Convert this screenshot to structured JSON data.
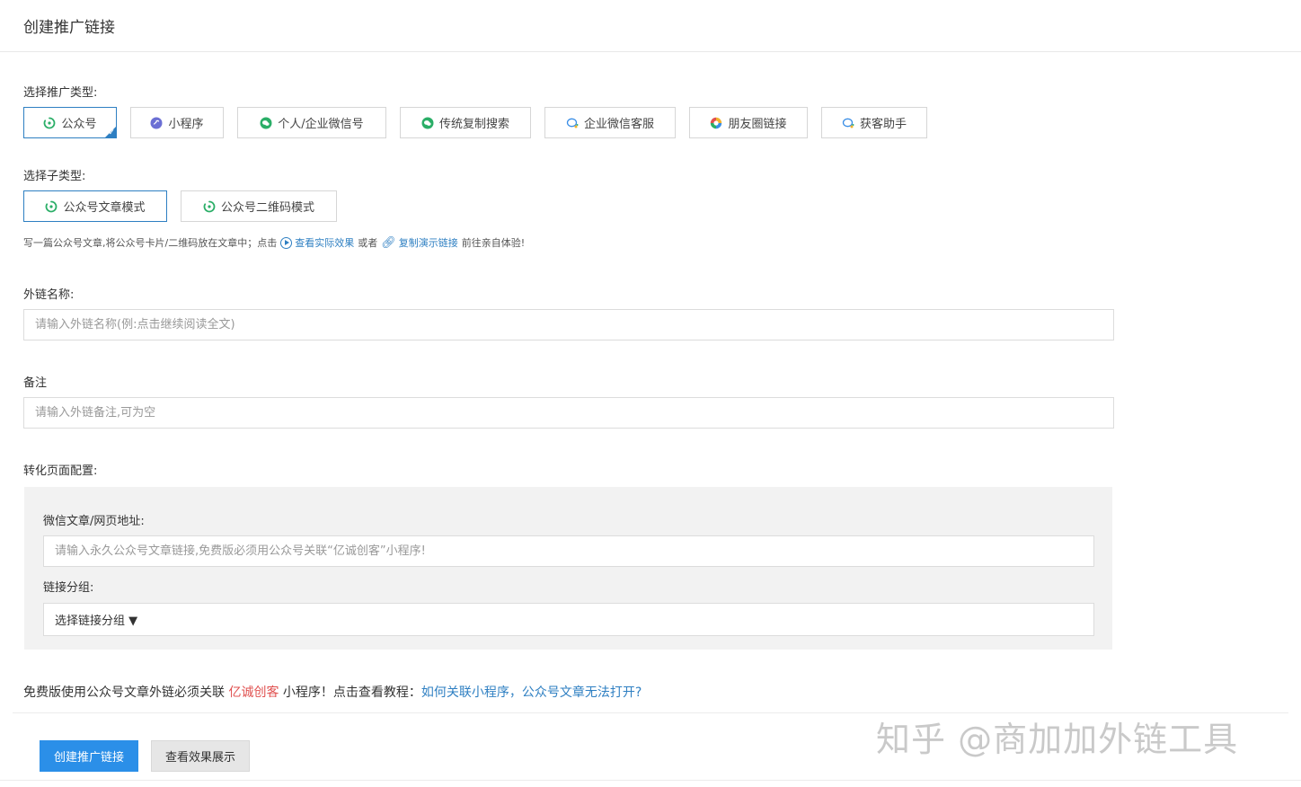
{
  "header": {
    "title": "创建推广链接"
  },
  "promo_type": {
    "label": "选择推广类型:",
    "options": [
      {
        "label": "公众号",
        "icon": "wechat-official-icon",
        "active": true
      },
      {
        "label": "小程序",
        "icon": "mini-program-icon",
        "active": false
      },
      {
        "label": "个人/企业微信号",
        "icon": "wechat-icon",
        "active": false
      },
      {
        "label": "传统复制搜索",
        "icon": "wechat-icon",
        "active": false
      },
      {
        "label": "企业微信客服",
        "icon": "wecom-icon",
        "active": false
      },
      {
        "label": "朋友圈链接",
        "icon": "moments-icon",
        "active": false
      },
      {
        "label": "获客助手",
        "icon": "wecom-icon",
        "active": false
      }
    ]
  },
  "sub_type": {
    "label": "选择子类型:",
    "options": [
      {
        "label": "公众号文章模式",
        "active": true
      },
      {
        "label": "公众号二维码模式",
        "active": false
      }
    ]
  },
  "hint": {
    "text1": "写一篇公众号文章,将公众号卡片/二维码放在文章中；点击",
    "link1": "查看实际效果",
    "text2": "或者",
    "link2": "复制演示链接",
    "text3": "前往亲自体验!"
  },
  "link_name": {
    "label": "外链名称:",
    "placeholder": "请输入外链名称(例:点击继续阅读全文)"
  },
  "remark": {
    "label": "备注",
    "placeholder": "请输入外链备注,可为空"
  },
  "conversion": {
    "label": "转化页面配置:",
    "url_label": "微信文章/网页地址:",
    "url_placeholder": "请输入永久公众号文章链接,免费版必须用公众号关联“亿诚创客”小程序!",
    "group_label": "链接分组:",
    "group_value": "选择链接分组 ▼"
  },
  "notice": {
    "text1": "免费版使用公众号文章外链必须关联",
    "brand": "亿诚创客",
    "text2": "小程序！点击查看教程：",
    "link": "如何关联小程序，公众号文章无法打开?"
  },
  "actions": {
    "create": "创建推广链接",
    "preview": "查看效果展示"
  },
  "watermark": "知乎 @商加加外链工具",
  "colors": {
    "accent": "#2e7fc2",
    "primary_button": "#2b8fe8",
    "brand_red": "#e0504f",
    "wechat_green": "#2aae67"
  }
}
